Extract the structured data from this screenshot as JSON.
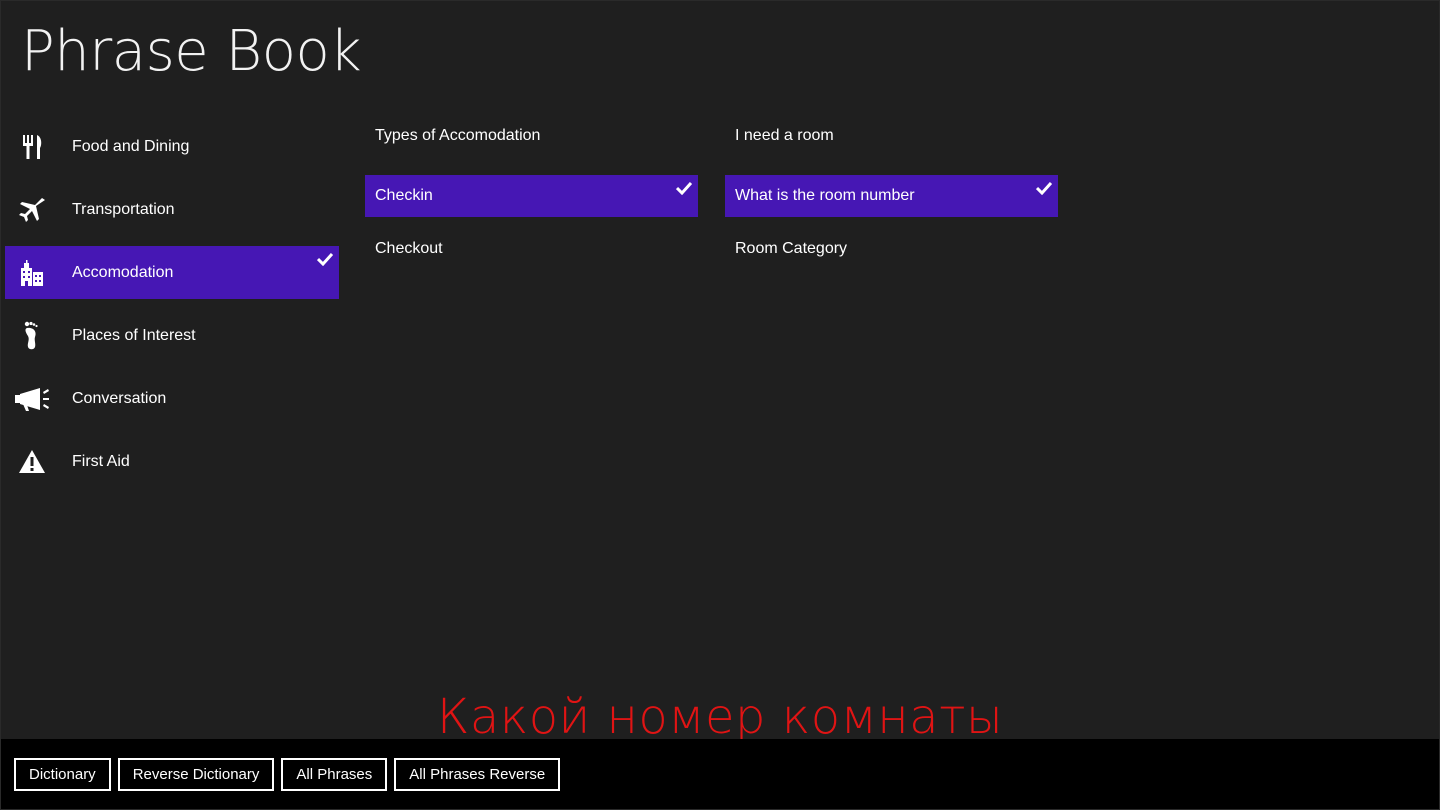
{
  "app": {
    "title": "Phrase Book"
  },
  "categories": [
    {
      "label": "Food and Dining",
      "icon": "fork-knife-icon",
      "selected": false
    },
    {
      "label": "Transportation",
      "icon": "airplane-icon",
      "selected": false
    },
    {
      "label": "Accomodation",
      "icon": "hotel-building-icon",
      "selected": true
    },
    {
      "label": "Places of Interest",
      "icon": "footprint-icon",
      "selected": false
    },
    {
      "label": "Conversation",
      "icon": "megaphone-icon",
      "selected": false
    },
    {
      "label": "First Aid",
      "icon": "warning-icon",
      "selected": false
    }
  ],
  "subcategories": [
    {
      "label": "Types of Accomodation",
      "selected": false
    },
    {
      "label": "Checkin",
      "selected": true
    },
    {
      "label": "Checkout",
      "selected": false
    }
  ],
  "phrases": [
    {
      "label": "I need a room",
      "selected": false
    },
    {
      "label": "What is the room number",
      "selected": true
    },
    {
      "label": "Room Category",
      "selected": false
    }
  ],
  "translation": {
    "text": "Какой номер комнаты"
  },
  "app_bar": {
    "buttons": [
      {
        "label": "Dictionary"
      },
      {
        "label": "Reverse Dictionary"
      },
      {
        "label": "All Phrases"
      },
      {
        "label": "All Phrases Reverse"
      }
    ]
  },
  "colors": {
    "background": "#1f1f1f",
    "selection": "#4617b4",
    "translation_text": "#e01414",
    "app_bar": "#000000"
  }
}
